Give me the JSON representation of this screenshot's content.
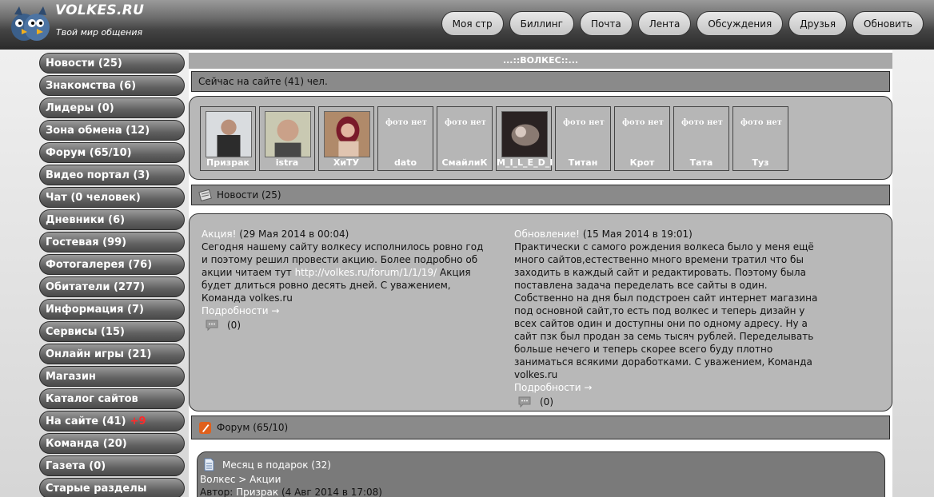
{
  "header": {
    "logo_title": "VOLKES.RU",
    "slogan": "Твой мир общения",
    "nav": [
      "Моя стр",
      "Биллинг",
      "Почта",
      "Лента",
      "Обсуждения",
      "Друзья",
      "Обновить"
    ]
  },
  "sidebar": {
    "items": [
      {
        "label": "Новости (25)"
      },
      {
        "label": "Знакомства (6)"
      },
      {
        "label": "Лидеры (0)"
      },
      {
        "label": "Зона обмена (12)"
      },
      {
        "label": "Форум (65/10)"
      },
      {
        "label": "Видео портал (3)"
      },
      {
        "label": "Чат (0 человек)"
      },
      {
        "label": "Дневники (6)"
      },
      {
        "label": "Гостевая (99)"
      },
      {
        "label": "Фотогалерея (76)"
      },
      {
        "label": "Обитатели (277)"
      },
      {
        "label": "Информация (7)"
      },
      {
        "label": "Сервисы (15)"
      },
      {
        "label": "Онлайн игры (21)"
      },
      {
        "label": "Магазин"
      },
      {
        "label": "Каталог сайтов"
      },
      {
        "label": "На сайте (41)",
        "extra": "+9"
      },
      {
        "label": "Команда (20)"
      },
      {
        "label": "Газета (0)"
      },
      {
        "label": "Старые разделы"
      }
    ]
  },
  "site_header": "...::ВОЛКЕС::...",
  "online": {
    "text": "Сейчас на сайте (41) чел.",
    "no_photo": "фото нет",
    "users": [
      {
        "name": "Призрак",
        "photo": true
      },
      {
        "name": "istra",
        "photo": true
      },
      {
        "name": "ХиТУ",
        "photo": true
      },
      {
        "name": "dato",
        "photo": false
      },
      {
        "name": "СмайлиК",
        "photo": false
      },
      {
        "name": "M_I_L_E_D_I",
        "photo": true
      },
      {
        "name": "Титан",
        "photo": false
      },
      {
        "name": "Крот",
        "photo": false
      },
      {
        "name": "Тата",
        "photo": false
      },
      {
        "name": "Туз",
        "photo": false
      }
    ]
  },
  "news": {
    "header": "Новости (25)",
    "more_label": "Подробности →",
    "items": [
      {
        "title": "Акция!",
        "date": "(29 Мая 2014 в 00:04)",
        "text_before": "Сегодня нашему сайту волкесу исполнилось ровно год и поэтому решил провести акцию. Более подробно об акции читаем тут ",
        "link": "http://volkes.ru/forum/1/1/19/",
        "text_after": " Акция будет длиться ровно десять дней. С уважением, Команда volkes.ru",
        "comments": "(0)"
      },
      {
        "title": "Обновление!",
        "date": "(15 Мая 2014 в 19:01)",
        "text": "Практически с самого рождения волкеса было у меня ещё много сайтов,естественно много времени тратил что бы заходить в каждый сайт и редактировать. Поэтому была поставлена задача переделать все сайты в один. Собственно на дня был подстроен сайт интернет магазина под основной сайт,то есть под волкес и теперь дизайн у всех сайтов один и доступны они по одному адресу. Ну а сайт пзк был продан за семь тысяч рублей. Переделывать больше нечего и теперь скорее всего буду плотно заниматься всякими доработками. С уважением, Команда volkes.ru",
        "comments": "(0)"
      }
    ]
  },
  "forum": {
    "header": "Форум (65/10)",
    "topic_title": "Месяц в подарок (32)",
    "crumb_a": "Волкес",
    "crumb_sep": " > ",
    "crumb_b": "Акции",
    "author_label": "Автор: ",
    "author": "Призрак",
    "date": " (4 Авг 2014 в 17:08)"
  }
}
